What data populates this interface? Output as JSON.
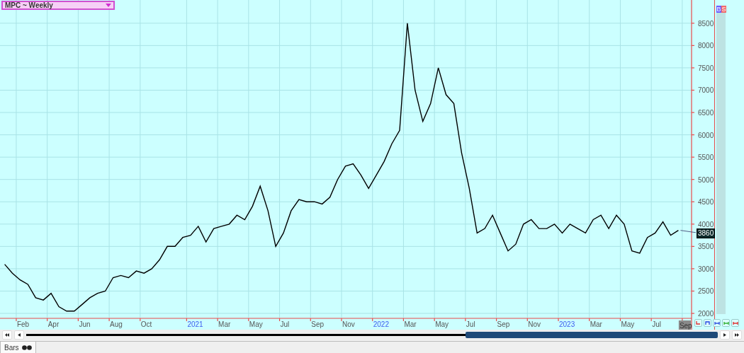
{
  "symbol_selector": {
    "label": "MPC ~ Weekly"
  },
  "trade_buttons": [
    {
      "label": "B",
      "kind": "buy"
    },
    {
      "label": "S",
      "kind": "sell"
    }
  ],
  "chart": {
    "chart_data": {
      "type": "line",
      "categories": [
        null,
        null,
        "Feb",
        null,
        null,
        null,
        "Apr",
        null,
        null,
        null,
        "Jun",
        null,
        null,
        null,
        "Aug",
        null,
        null,
        null,
        "Oct",
        null,
        null,
        null,
        null,
        null,
        "2021",
        null,
        null,
        null,
        "Mar",
        null,
        null,
        null,
        "May",
        null,
        null,
        null,
        "Jul",
        null,
        null,
        null,
        "Sep",
        null,
        null,
        null,
        "Nov",
        null,
        null,
        null,
        "2022",
        null,
        null,
        null,
        "Mar",
        null,
        null,
        null,
        "May",
        null,
        null,
        null,
        "Jul",
        null,
        null,
        null,
        "Sep",
        null,
        null,
        null,
        "Nov",
        null,
        null,
        null,
        "2023",
        null,
        null,
        null,
        "Mar",
        null,
        null,
        null,
        "May",
        null,
        null,
        null,
        "Jul",
        null,
        null,
        null,
        "Sep"
      ],
      "values": [
        3100,
        2900,
        2750,
        2650,
        2350,
        2300,
        2450,
        2150,
        2050,
        2050,
        2200,
        2350,
        2450,
        2500,
        2800,
        2850,
        2800,
        2950,
        2900,
        3000,
        3200,
        3500,
        3500,
        3700,
        3750,
        3950,
        3600,
        3900,
        3950,
        4000,
        4200,
        4100,
        4400,
        4850,
        4300,
        3500,
        3800,
        4300,
        4550,
        4500,
        4500,
        4450,
        4600,
        5000,
        5300,
        5350,
        5100,
        4800,
        5100,
        5400,
        5800,
        6100,
        8500,
        7000,
        6300,
        6700,
        7500,
        6900,
        6700,
        5600,
        4800,
        3800,
        3900,
        4200,
        3800,
        3400,
        3550,
        4000,
        4100,
        3900,
        3900,
        4000,
        3800,
        4000,
        3900,
        3800,
        4100,
        4200,
        3900,
        4200,
        4000,
        3400,
        3350,
        3700,
        3800,
        4050,
        3750,
        3860,
        null
      ],
      "ylim": [
        1905,
        9020
      ],
      "grid": true,
      "yticks": [
        2000,
        2500,
        3000,
        3500,
        4000,
        4500,
        5000,
        5500,
        6000,
        6500,
        7000,
        7500,
        8000,
        8500
      ]
    },
    "last_price_tag": "3860"
  },
  "status_bar": {
    "tabs": [
      {
        "label": "Bars",
        "selected": true
      }
    ]
  }
}
